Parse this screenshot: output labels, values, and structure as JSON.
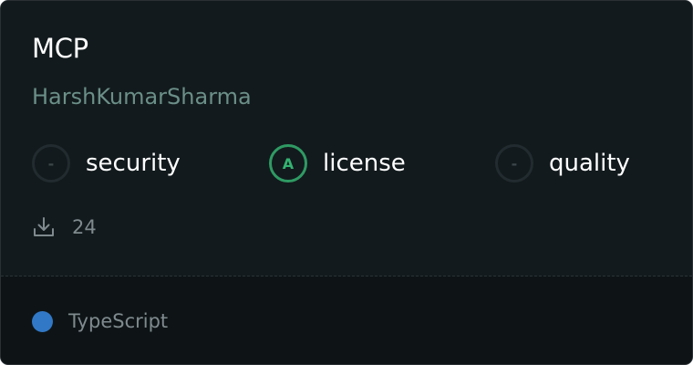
{
  "card": {
    "title": "MCP",
    "author": "HarshKumarSharma",
    "metrics": [
      {
        "grade": "-",
        "label": "security"
      },
      {
        "grade": "A",
        "label": "license"
      },
      {
        "grade": "-",
        "label": "quality"
      }
    ],
    "downloads": {
      "icon": "download-icon",
      "count": "24"
    },
    "language": {
      "name": "TypeScript",
      "color": "#3178c6"
    }
  }
}
